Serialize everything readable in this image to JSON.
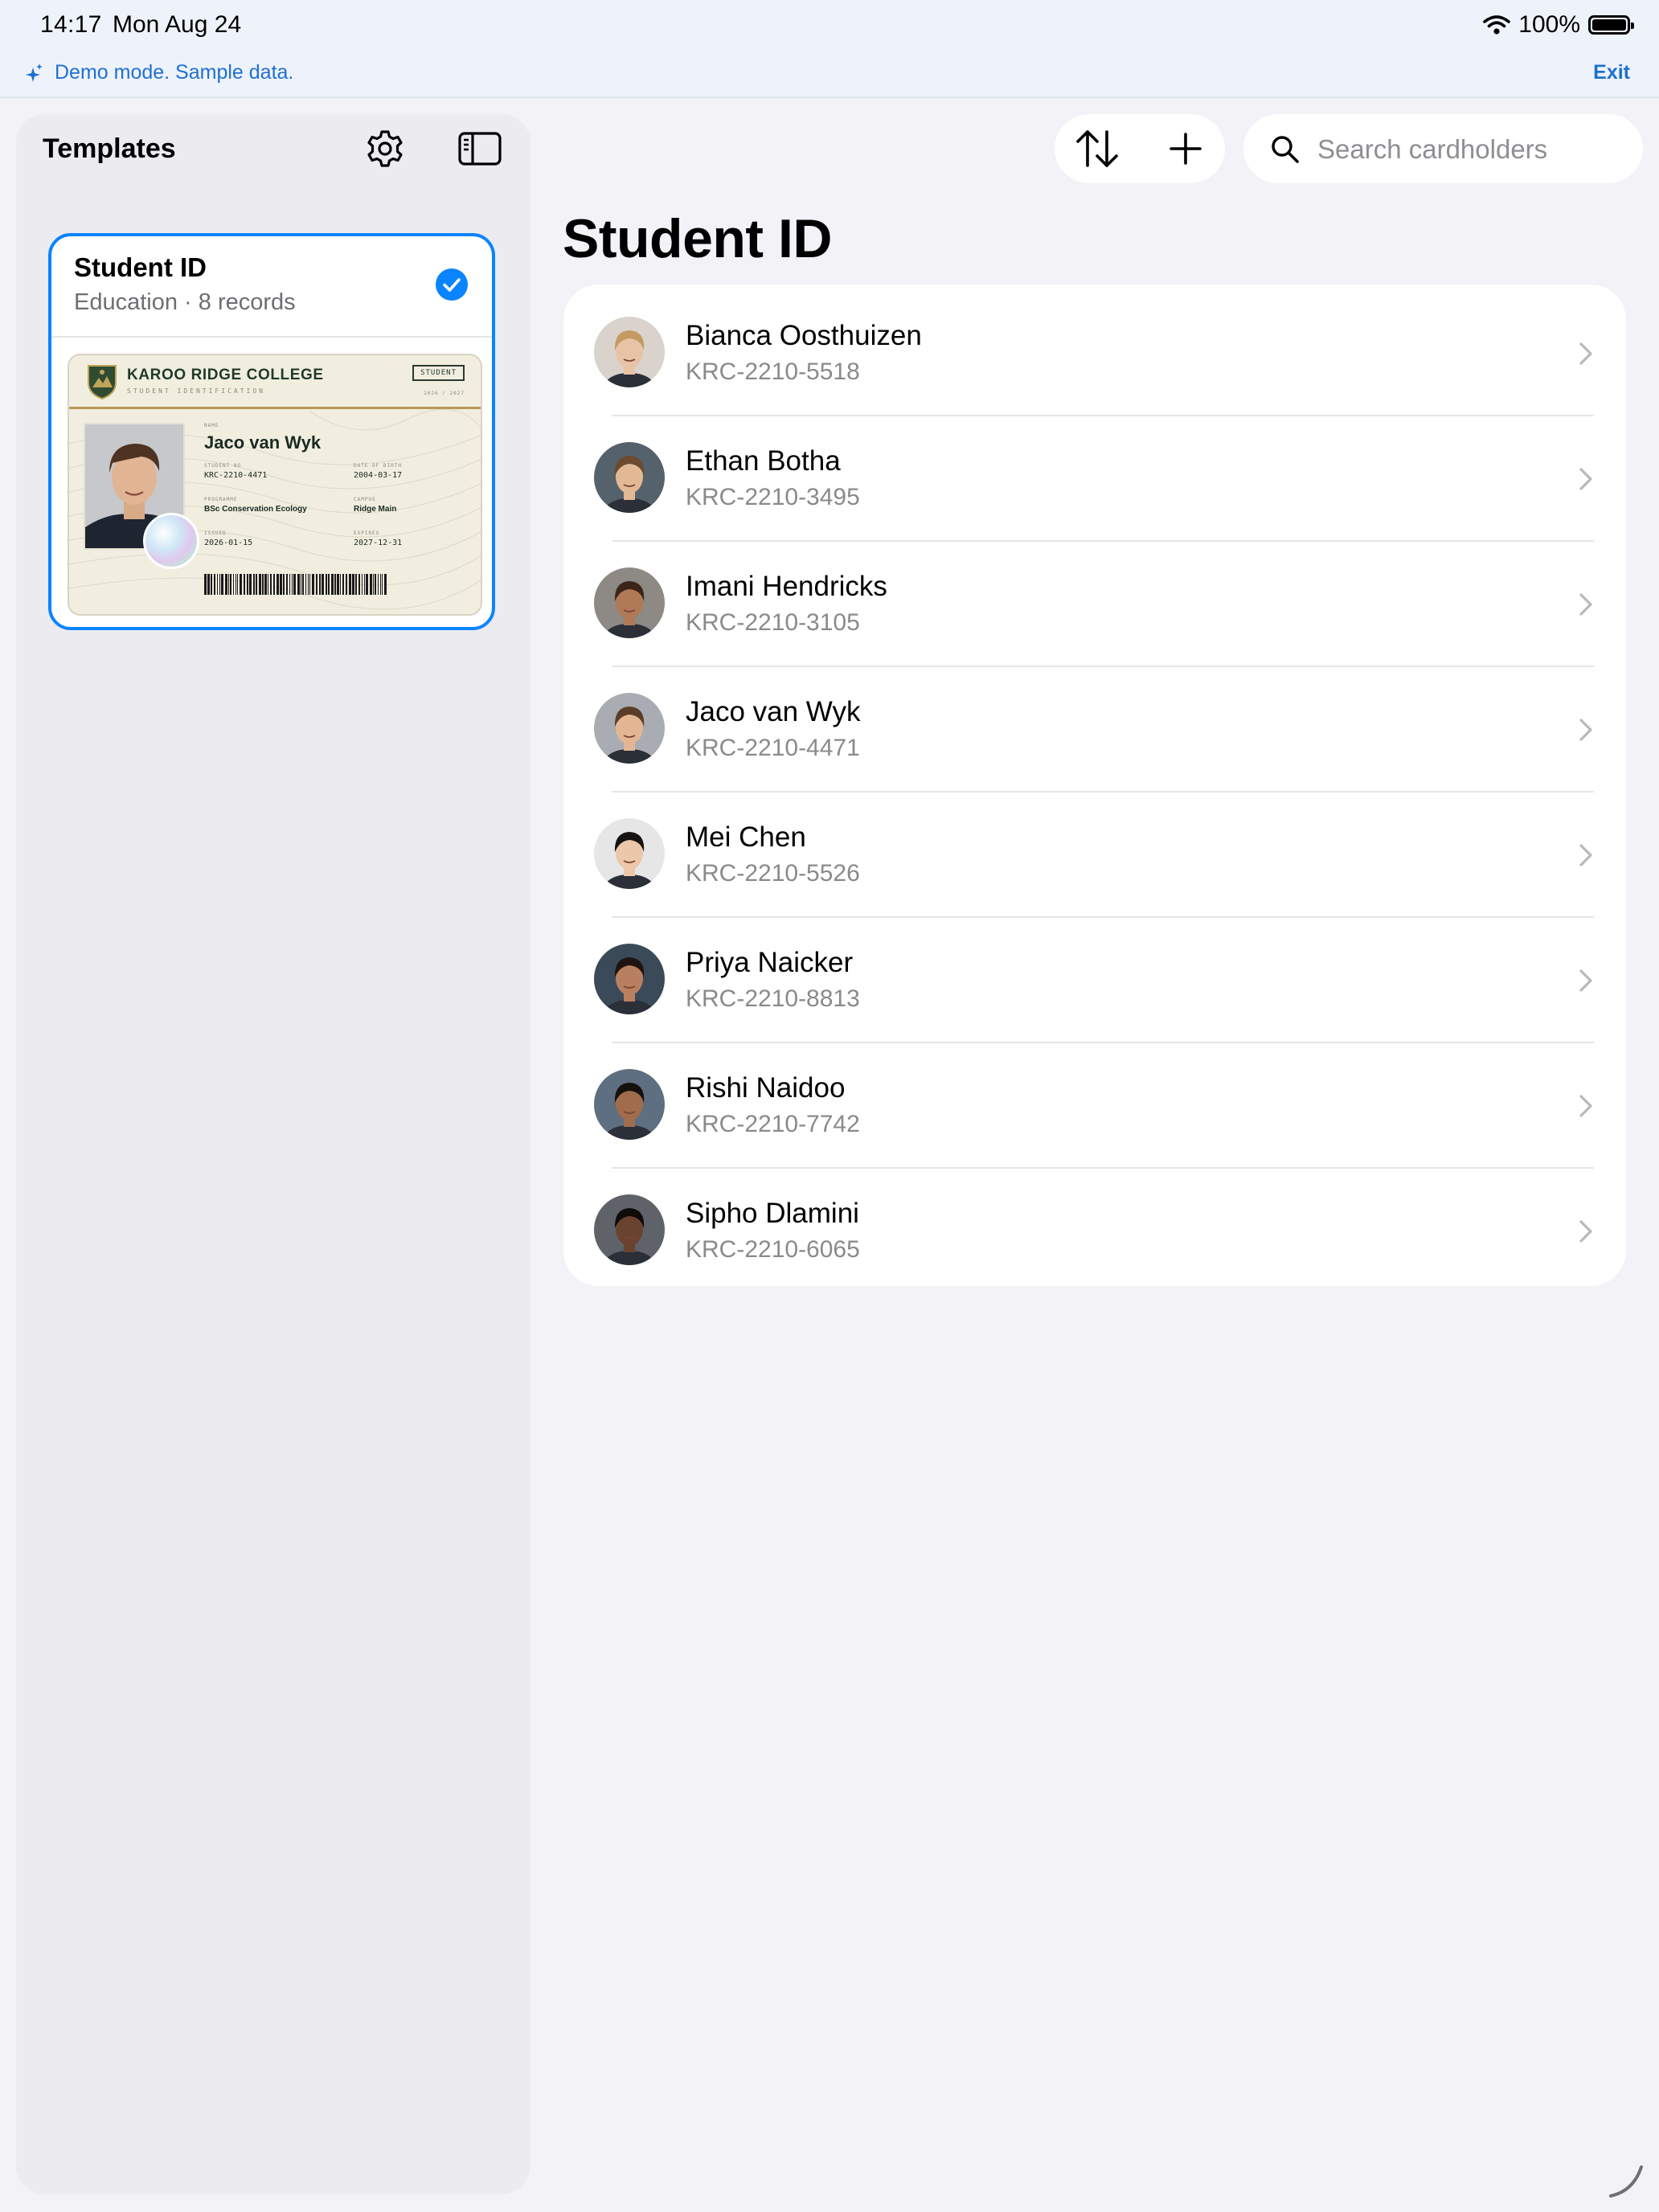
{
  "status": {
    "time": "14:17",
    "date": "Mon Aug 24",
    "battery": "100%"
  },
  "demo": {
    "message": "Demo mode. Sample data.",
    "exit_label": "Exit"
  },
  "sidebar": {
    "title": "Templates",
    "template": {
      "name": "Student ID",
      "subtitle": "Education · 8 records",
      "selected": true,
      "card": {
        "college": "KAROO RIDGE COLLEGE",
        "college_sub": "STUDENT IDENTIFICATION",
        "badge": "STUDENT",
        "badge_sub": "2026 / 2027",
        "name_label": "NAME",
        "name": "Jaco van Wyk",
        "student_no_label": "STUDENT NO",
        "student_no": "KRC-2210-4471",
        "dob_label": "DATE OF BIRTH",
        "dob": "2004-03-17",
        "program_label": "PROGRAMME",
        "program": "BSc Conservation Ecology",
        "campus_label": "CAMPUS",
        "campus": "Ridge Main",
        "issued_label": "ISSUED",
        "issued": "2026-01-15",
        "expires_label": "EXPIRES",
        "expires": "2027-12-31"
      }
    }
  },
  "toolbar": {
    "sort_icon": "sort-arrows-icon",
    "add_icon": "plus-icon",
    "search_placeholder": "Search cardholders"
  },
  "main": {
    "title": "Student ID",
    "rows": [
      {
        "name": "Bianca Oosthuizen",
        "id": "KRC-2210-5518",
        "skin": "#e8c3a5",
        "hair": "#c59a62",
        "bg": "#d9d3cc"
      },
      {
        "name": "Ethan Botha",
        "id": "KRC-2210-3495",
        "skin": "#e3b995",
        "hair": "#6b4a2e",
        "bg": "#55616b"
      },
      {
        "name": "Imani Hendricks",
        "id": "KRC-2210-3105",
        "skin": "#b07a57",
        "hair": "#3b2418",
        "bg": "#8d8984"
      },
      {
        "name": "Jaco van Wyk",
        "id": "KRC-2210-4471",
        "skin": "#e2b693",
        "hair": "#5a3d28",
        "bg": "#a9adb3"
      },
      {
        "name": "Mei Chen",
        "id": "KRC-2210-5526",
        "skin": "#ecc7aa",
        "hair": "#16120f",
        "bg": "#e6e6e6"
      },
      {
        "name": "Priya Naicker",
        "id": "KRC-2210-8813",
        "skin": "#b98060",
        "hair": "#1e1410",
        "bg": "#3b4a58"
      },
      {
        "name": "Rishi Naidoo",
        "id": "KRC-2210-7742",
        "skin": "#a06c4c",
        "hair": "#15110e",
        "bg": "#5d6f80"
      },
      {
        "name": "Sipho Dlamini",
        "id": "KRC-2210-6065",
        "skin": "#6a4330",
        "hair": "#0f0c0a",
        "bg": "#5f6369"
      }
    ]
  },
  "colors": {
    "accent": "#0a84ff",
    "demo_text": "#1f6fd1",
    "background": "#f2f2f7"
  }
}
